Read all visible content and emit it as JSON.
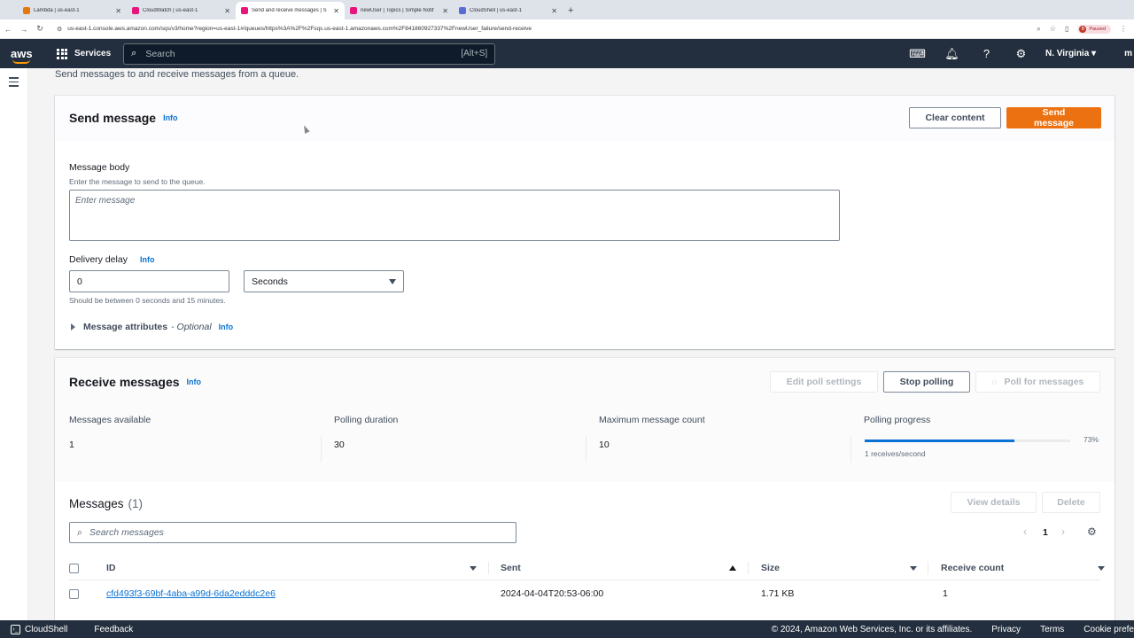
{
  "browser": {
    "tabs": [
      {
        "title": "Lambda | us-east-1",
        "color": "#e47911"
      },
      {
        "title": "CloudWatch | us-east-1",
        "color": "#e7157b"
      },
      {
        "title": "Send and receive messages | S",
        "color": "#e7157b",
        "active": true
      },
      {
        "title": "newUser | Topics | Simple Notif",
        "color": "#e7157b"
      },
      {
        "title": "CloudShell | us-east-1",
        "color": "#5a6bd6"
      }
    ],
    "url": "us-east-1.console.aws.amazon.com/sqs/v3/home?region=us-east-1#/queues/https%3A%2F%2Fsqs.us-east-1.amazonaws.com%2F841860927337%2FnewUser_failure/send-receive",
    "profile_status": "Paused",
    "profile_initial": "B"
  },
  "aws_nav": {
    "logo": "aws",
    "services_label": "Services",
    "search_placeholder": "Search",
    "search_shortcut": "[Alt+S]",
    "region": "N. Virginia",
    "account_initial": "m"
  },
  "page": {
    "subtitle": "Send messages to and receive messages from a queue."
  },
  "send": {
    "title": "Send message",
    "info": "Info",
    "clear_button": "Clear content",
    "send_button": "Send message",
    "body_label": "Message body",
    "body_desc": "Enter the message to send to the queue.",
    "body_placeholder": "Enter message",
    "delay_label": "Delivery delay",
    "delay_info": "Info",
    "delay_value": "0",
    "delay_unit": "Seconds",
    "delay_hint": "Should be between 0 seconds and 15 minutes.",
    "attributes_label": "Message attributes",
    "attributes_optional": "- Optional",
    "attributes_info": "Info"
  },
  "receive": {
    "title": "Receive messages",
    "info": "Info",
    "edit_poll_button": "Edit poll settings",
    "stop_polling_button": "Stop polling",
    "poll_button": "Poll for messages",
    "stats": {
      "available_label": "Messages available",
      "available_value": "1",
      "duration_label": "Polling duration",
      "duration_value": "30",
      "max_label": "Maximum message count",
      "max_value": "10",
      "progress_label": "Polling progress",
      "progress_percent": "73%",
      "progress_fraction": 0.73,
      "rate": "1 receives/second"
    }
  },
  "messages": {
    "title": "Messages",
    "count": "(1)",
    "view_details_button": "View details",
    "delete_button": "Delete",
    "search_placeholder": "Search messages",
    "page": "1",
    "columns": {
      "id": "ID",
      "sent": "Sent",
      "size": "Size",
      "receive_count": "Receive count"
    },
    "rows": [
      {
        "id": "cfd493f3-69bf-4aba-a99d-6da2edddc2e6",
        "sent": "2024-04-04T20:53-06:00",
        "size": "1.71 KB",
        "receive_count": "1"
      }
    ]
  },
  "footer": {
    "cloudshell": "CloudShell",
    "feedback": "Feedback",
    "copyright": "© 2024, Amazon Web Services, Inc. or its affiliates.",
    "privacy": "Privacy",
    "terms": "Terms",
    "cookie": "Cookie prefe"
  },
  "colors": {
    "aws_nav": "#232f3e",
    "primary_button": "#ec7211",
    "link": "#0972d3"
  }
}
